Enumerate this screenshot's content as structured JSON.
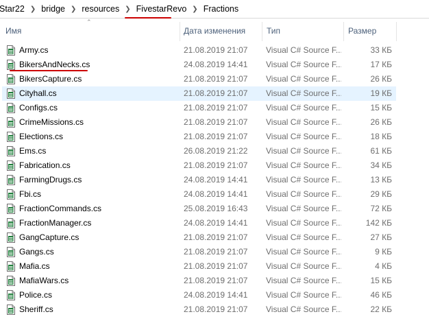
{
  "breadcrumb": [
    "Star22",
    "bridge",
    "resources",
    "FivestarRevo",
    "Fractions"
  ],
  "columns": {
    "name": "Имя",
    "date": "Дата изменения",
    "type": "Тип",
    "size": "Размер"
  },
  "colors": {
    "selected_row": "#e5f3ff",
    "annotation_marker": "#cc0000",
    "icon_green": "#1e7d3a"
  },
  "files": [
    {
      "name": "Army.cs",
      "date": "21.08.2019 21:07",
      "type": "Visual C# Source F...",
      "size": "33 КБ"
    },
    {
      "name": "BikersAndNecks.cs",
      "date": "24.08.2019 14:41",
      "type": "Visual C# Source F...",
      "size": "17 КБ"
    },
    {
      "name": "BikersCapture.cs",
      "date": "21.08.2019 21:07",
      "type": "Visual C# Source F...",
      "size": "26 КБ"
    },
    {
      "name": "Cityhall.cs",
      "date": "21.08.2019 21:07",
      "type": "Visual C# Source F...",
      "size": "19 КБ"
    },
    {
      "name": "Configs.cs",
      "date": "21.08.2019 21:07",
      "type": "Visual C# Source F...",
      "size": "15 КБ"
    },
    {
      "name": "CrimeMissions.cs",
      "date": "21.08.2019 21:07",
      "type": "Visual C# Source F...",
      "size": "26 КБ"
    },
    {
      "name": "Elections.cs",
      "date": "21.08.2019 21:07",
      "type": "Visual C# Source F...",
      "size": "18 КБ"
    },
    {
      "name": "Ems.cs",
      "date": "26.08.2019 21:22",
      "type": "Visual C# Source F...",
      "size": "61 КБ"
    },
    {
      "name": "Fabrication.cs",
      "date": "21.08.2019 21:07",
      "type": "Visual C# Source F...",
      "size": "34 КБ"
    },
    {
      "name": "FarmingDrugs.cs",
      "date": "24.08.2019 14:41",
      "type": "Visual C# Source F...",
      "size": "13 КБ"
    },
    {
      "name": "Fbi.cs",
      "date": "24.08.2019 14:41",
      "type": "Visual C# Source F...",
      "size": "29 КБ"
    },
    {
      "name": "FractionCommands.cs",
      "date": "25.08.2019 16:43",
      "type": "Visual C# Source F...",
      "size": "72 КБ"
    },
    {
      "name": "FractionManager.cs",
      "date": "24.08.2019 14:41",
      "type": "Visual C# Source F...",
      "size": "142 КБ"
    },
    {
      "name": "GangCapture.cs",
      "date": "21.08.2019 21:07",
      "type": "Visual C# Source F...",
      "size": "27 КБ"
    },
    {
      "name": "Gangs.cs",
      "date": "21.08.2019 21:07",
      "type": "Visual C# Source F...",
      "size": "9 КБ"
    },
    {
      "name": "Mafia.cs",
      "date": "21.08.2019 21:07",
      "type": "Visual C# Source F...",
      "size": "4 КБ"
    },
    {
      "name": "MafiaWars.cs",
      "date": "21.08.2019 21:07",
      "type": "Visual C# Source F...",
      "size": "15 КБ"
    },
    {
      "name": "Police.cs",
      "date": "24.08.2019 14:41",
      "type": "Visual C# Source F...",
      "size": "46 КБ"
    },
    {
      "name": "Sheriff.cs",
      "date": "21.08.2019 21:07",
      "type": "Visual C# Source F...",
      "size": "22 КБ"
    }
  ],
  "selected_index": 3,
  "icon": "csharp-file-icon"
}
